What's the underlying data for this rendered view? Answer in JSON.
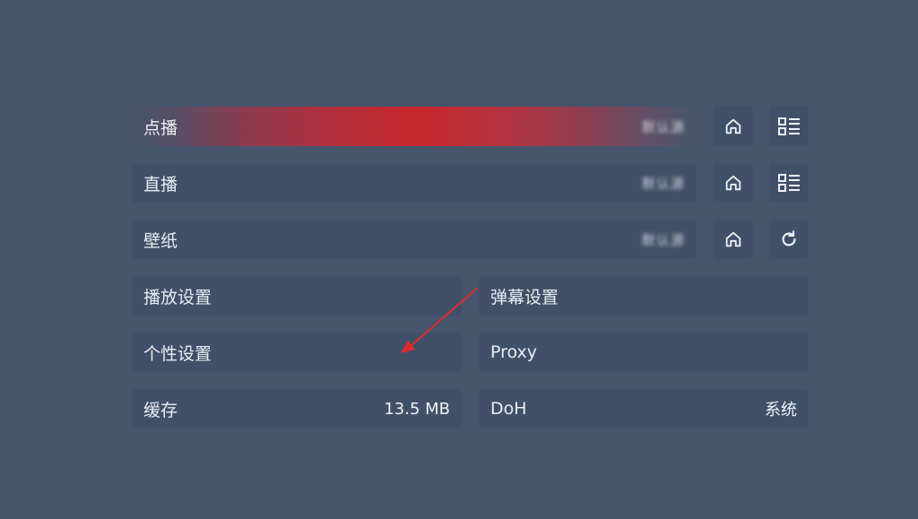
{
  "rows": [
    {
      "label": "点播",
      "value": "默认源"
    },
    {
      "label": "直播",
      "value": "默认源"
    },
    {
      "label": "壁纸",
      "value": "默认源"
    }
  ],
  "settings": {
    "play": {
      "label": "播放设置"
    },
    "danmaku": {
      "label": "弹幕设置"
    },
    "personal": {
      "label": "个性设置"
    },
    "proxy": {
      "label": "Proxy"
    },
    "cache": {
      "label": "缓存",
      "value": "13.5 MB"
    },
    "doh": {
      "label": "DoH",
      "value": "系统"
    }
  },
  "icons": {
    "home": "home-icon",
    "list": "list-icon",
    "refresh": "refresh-icon"
  },
  "colors": {
    "background": "#45556c",
    "card": "#405068",
    "highlight_red": "#c7272c",
    "annotation_arrow": "#e02a2a"
  }
}
